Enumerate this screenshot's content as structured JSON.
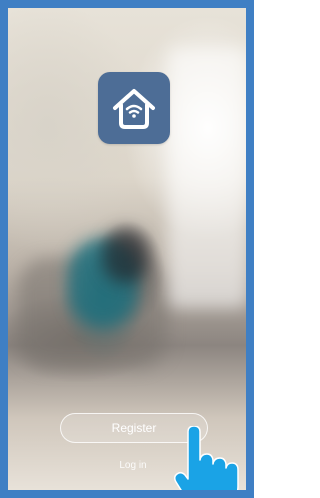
{
  "app": {
    "icon_name": "smart-home-wifi-icon",
    "icon_color": "#4d6d96"
  },
  "actions": {
    "register_label": "Register",
    "login_label": "Log in"
  },
  "overlay": {
    "pointer_icon": "hand-pointer-icon",
    "pointer_color": "#1aa3e6"
  },
  "frame": {
    "border_color": "#3f7fc4"
  }
}
